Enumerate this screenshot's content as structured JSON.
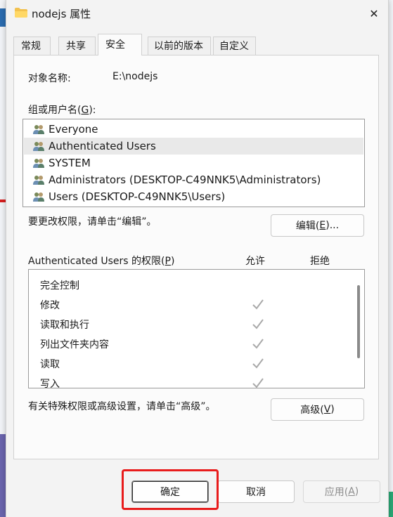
{
  "window": {
    "title": "nodejs 属性",
    "close_glyph": "✕"
  },
  "tabs": [
    {
      "label": "常规"
    },
    {
      "label": "共享"
    },
    {
      "label": "安全"
    },
    {
      "label": "以前的版本"
    },
    {
      "label": "自定义"
    }
  ],
  "active_tab": "安全",
  "object": {
    "label": "对象名称:",
    "value": "E:\\nodejs"
  },
  "groups": {
    "label_prefix": "组或用户名(",
    "label_key": "G",
    "label_suffix": "):",
    "items": [
      {
        "name": "Everyone",
        "icon": "users-icon",
        "selected": false
      },
      {
        "name": "Authenticated Users",
        "icon": "users-icon",
        "selected": true
      },
      {
        "name": "SYSTEM",
        "icon": "users-icon",
        "selected": false
      },
      {
        "name": "Administrators (DESKTOP-C49NNK5\\Administrators)",
        "icon": "users-icon",
        "selected": false
      },
      {
        "name": "Users (DESKTOP-C49NNK5\\Users)",
        "icon": "users-icon",
        "selected": false
      }
    ]
  },
  "edit_hint": "要更改权限，请单击“编辑”。",
  "edit_button": {
    "pre": "编辑(",
    "key": "E",
    "post": ")..."
  },
  "permissions": {
    "label_prefix": "Authenticated Users 的权限(",
    "label_key": "P",
    "label_suffix": ")",
    "allow_header": "允许",
    "deny_header": "拒绝",
    "rows": [
      {
        "name": "完全控制",
        "allow": false,
        "deny": false
      },
      {
        "name": "修改",
        "allow": true,
        "deny": false
      },
      {
        "name": "读取和执行",
        "allow": true,
        "deny": false
      },
      {
        "name": "列出文件夹内容",
        "allow": true,
        "deny": false
      },
      {
        "name": "读取",
        "allow": true,
        "deny": false
      },
      {
        "name": "写入",
        "allow": true,
        "deny": false
      }
    ]
  },
  "advanced_hint": "有关特殊权限或高级设置，请单击“高级”。",
  "advanced_button": {
    "pre": "高级(",
    "key": "V",
    "post": ")"
  },
  "footer": {
    "ok": "确定",
    "cancel": "取消",
    "apply_pre": "应用(",
    "apply_key": "A",
    "apply_post": ")"
  },
  "colors": {
    "highlight": "#e81b1b",
    "check": "#a9a9a9",
    "folder": "#f2c14e"
  }
}
